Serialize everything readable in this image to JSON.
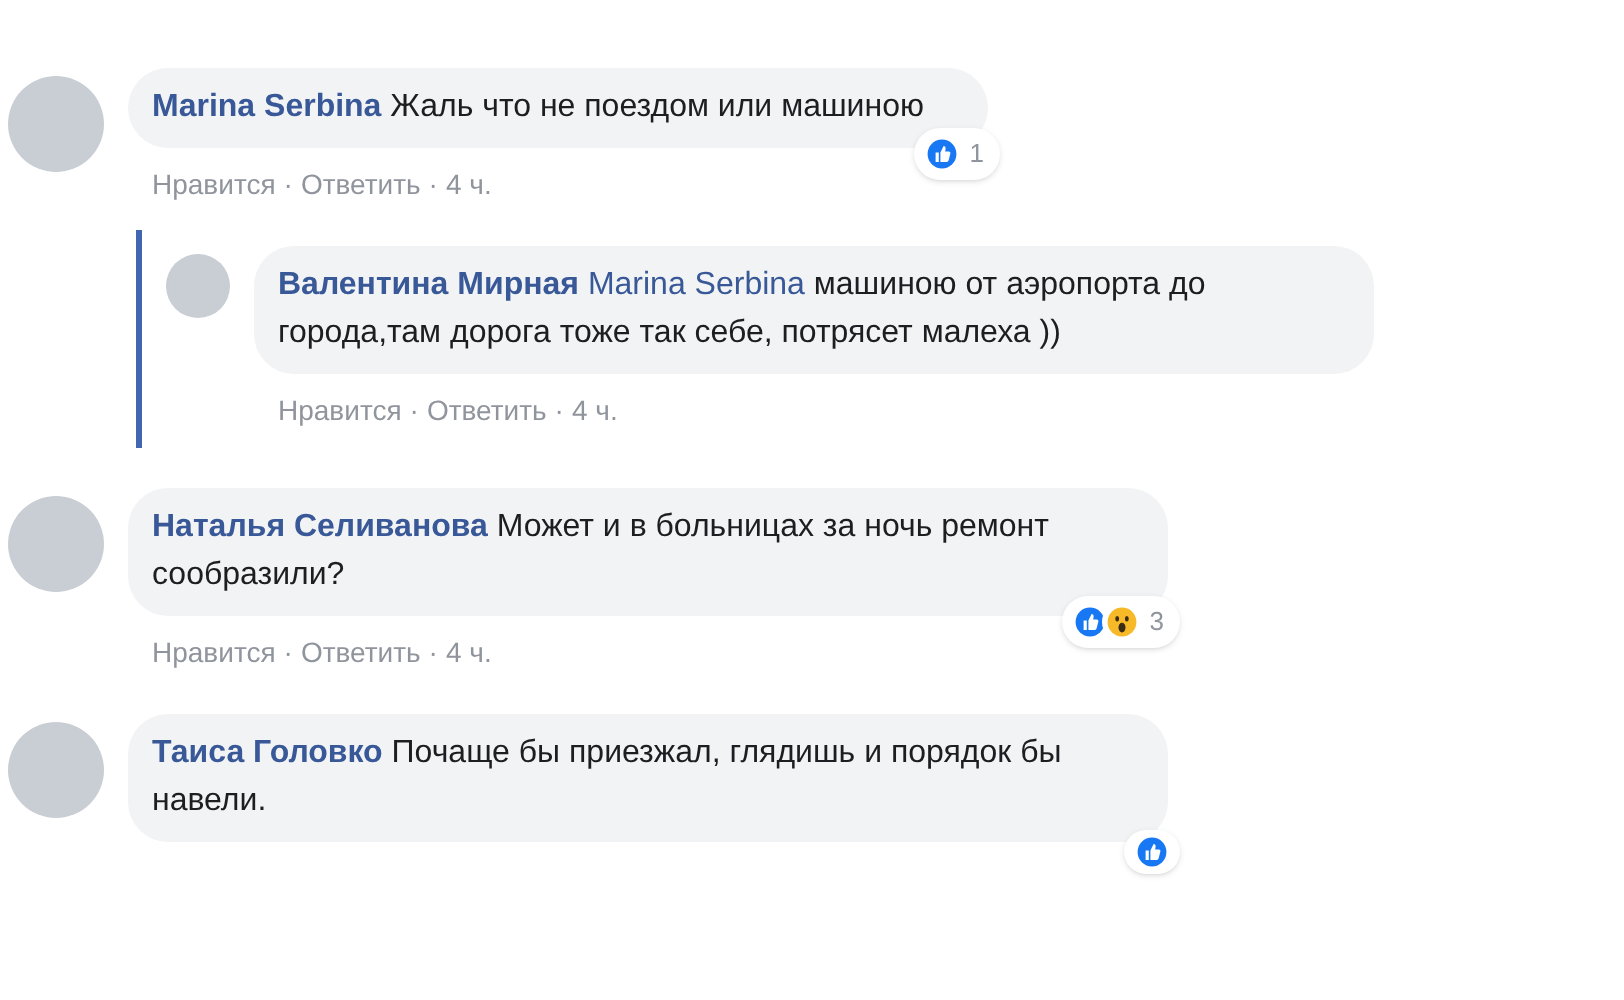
{
  "comments": [
    {
      "author": "Marina Serbina",
      "text": "Жаль что не поездом или машиною",
      "actions": [
        "Нравится",
        "Ответить",
        "4 ч."
      ],
      "separator": "·",
      "reactions": {
        "types": [
          {
            "kind": "like"
          }
        ],
        "count": "1"
      },
      "children": [
        {
          "author": "Валентина Мирная",
          "mention": "Marina Serbina",
          "text": "машиною от аэропорта до города,там дорога тоже так себе, потрясет малеха ))",
          "actions": [
            "Нравится",
            "Ответить",
            "4 ч."
          ],
          "separator": "·"
        }
      ]
    },
    {
      "author": "Наталья Селиванова",
      "text": "Может и в больницах за ночь ремонт сообразили?",
      "actions": [
        "Нравится",
        "Ответить",
        "4 ч."
      ],
      "separator": "·",
      "reactions": {
        "types": [
          {
            "kind": "like"
          },
          {
            "kind": "wow"
          }
        ],
        "count": "3"
      }
    },
    {
      "author": "Таиса Головко",
      "text": "Почаще бы приезжал, глядишь и порядок бы навели.",
      "reactions": {
        "types": [
          {
            "kind": "like"
          }
        ]
      }
    }
  ]
}
